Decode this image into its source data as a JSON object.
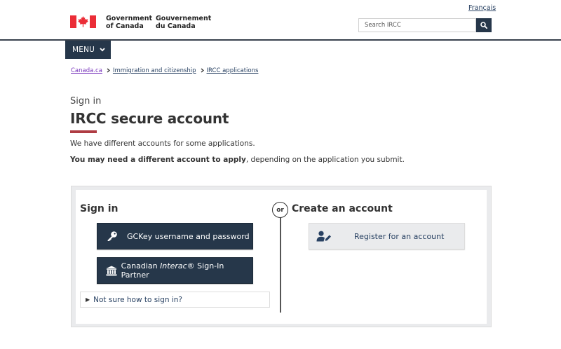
{
  "header": {
    "language_toggle": "Français",
    "wordmark_en": "Government\nof Canada",
    "wordmark_fr": "Gouvernement\ndu Canada",
    "search_placeholder": "Search IRCC",
    "menu_label": "MENU"
  },
  "breadcrumb": {
    "items": [
      "Canada.ca",
      "Immigration and citizenship",
      "IRCC applications"
    ]
  },
  "page": {
    "pre_title": "Sign in",
    "title": "IRCC secure account",
    "intro_line1": "We have different accounts for some applications.",
    "intro_line2_bold": "You may need a different account to apply",
    "intro_line2_rest": ", depending on the application you submit."
  },
  "sign_in": {
    "heading": "Sign in",
    "gckey_label": "GCKey username and password",
    "interac_prefix": "Canadian ",
    "interac_brand": "Interac",
    "interac_suffix": "® Sign-In Partner",
    "details_label": "Not sure how to sign in?"
  },
  "separator": {
    "label": "or"
  },
  "create_account": {
    "heading": "Create an account",
    "register_label": "Register for an account"
  },
  "colors": {
    "primary_dark": "#26374a",
    "accent_red": "#af3c43",
    "flag_red": "#eb2d37",
    "link": "#284162",
    "visited_link": "#7834bc"
  },
  "icons": {
    "search": "search-icon",
    "menu_chevron": "chevron-down-icon",
    "gckey": "key-icon",
    "interac": "bank-icon",
    "register": "user-edit-icon",
    "breadcrumb_sep": "chevron-right-icon",
    "details": "triangle-right-icon"
  }
}
